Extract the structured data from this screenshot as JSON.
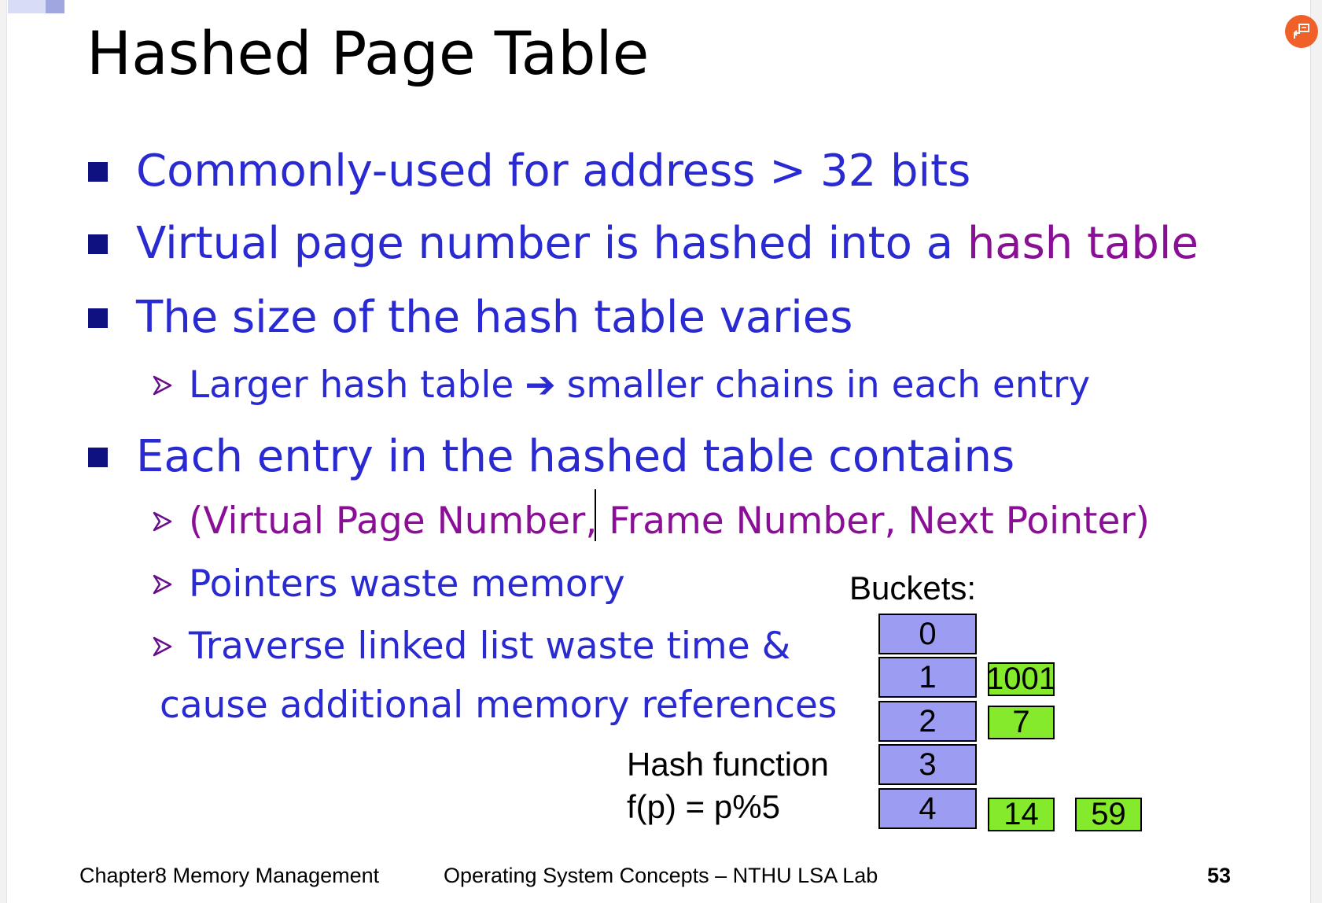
{
  "title": "Hashed Page Table",
  "bullets": [
    {
      "text": "Commonly-used for address > 32 bits"
    },
    {
      "text_before": "Virtual page number is hashed into a ",
      "highlight": "hash table"
    },
    {
      "text": "The size of the hash table varies"
    },
    {
      "text": "Each entry in the hashed table contains"
    }
  ],
  "subbullets": {
    "larger": {
      "before": "Larger hash table",
      "arrow": "➔",
      "after": "smaller chains in each entry"
    },
    "tuple": "(Virtual Page Number, Frame Number, Next Pointer)",
    "pointers": "Pointers waste memory",
    "traverse": "Traverse linked list waste time &",
    "traverse_cont": "cause additional memory references"
  },
  "diagram": {
    "buckets_label": "Buckets:",
    "hash_function_label": "Hash function",
    "hash_formula": "f(p) = p%5",
    "buckets": [
      "0",
      "1",
      "2",
      "3",
      "4"
    ],
    "entries": {
      "bucket1": [
        "1001"
      ],
      "bucket2": [
        "7"
      ],
      "bucket4": [
        "14",
        "59"
      ]
    },
    "colors": {
      "bucket_fill": "#9b9cf2",
      "entry_fill": "#86ea2c"
    }
  },
  "footer": {
    "left": "Chapter8 Memory Management",
    "center": "Operating System Concepts – NTHU LSA Lab",
    "page_number": "53"
  },
  "colors": {
    "bullet_text": "#2a2ad2",
    "highlight": "#8a0f96",
    "bullet_marker": "#0f1180",
    "badge": "#f0612a"
  },
  "icons": {
    "corner_badge": "share-screen-icon",
    "bullet_marker": "square-bullet-icon",
    "sub_marker": "arrowhead-bullet-icon"
  }
}
